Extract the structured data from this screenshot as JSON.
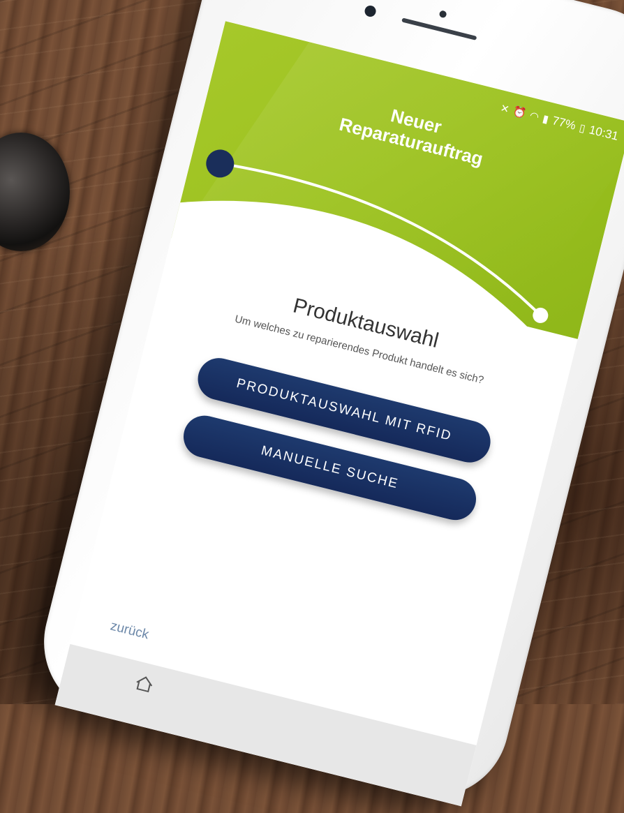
{
  "status_bar": {
    "battery": "77%",
    "time": "10:31",
    "icons": [
      "mute-icon",
      "alarm-icon",
      "wifi-icon",
      "signal-icon",
      "battery-icon"
    ]
  },
  "header": {
    "title_line1": "Neuer",
    "title_line2": "Reparaturauftrag",
    "progress": {
      "current_step": 1
    }
  },
  "content": {
    "title": "Produktauswahl",
    "subtitle": "Um welches zu reparierendes Produkt handelt es sich?"
  },
  "actions": {
    "rfid_label": "PRODUKTAUSWAHL MIT RFID",
    "manual_label": "MANUELLE SUCHE"
  },
  "footer": {
    "back_label": "zurück"
  },
  "colors": {
    "accent_green": "#9cc21f",
    "button_navy": "#15295a",
    "link_blue": "#6b87a8"
  }
}
